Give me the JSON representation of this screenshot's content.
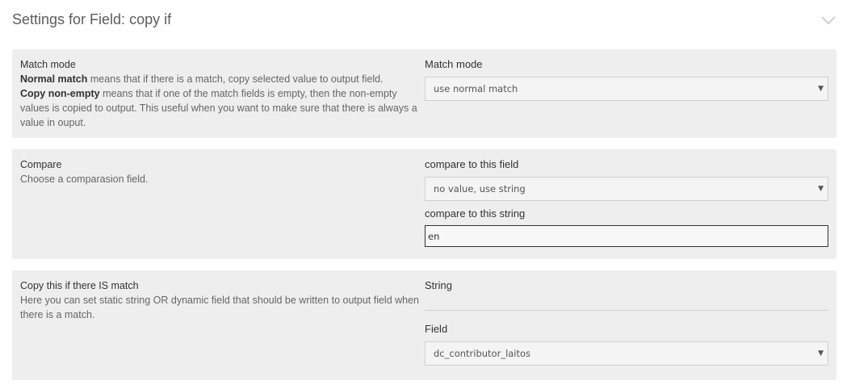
{
  "header": {
    "title": "Settings for Field: copy if"
  },
  "match_mode": {
    "title": "Match mode",
    "desc_bold_1": "Normal match",
    "desc_text_1": " means that if there is a match, copy selected value to output field.",
    "desc_bold_2": "Copy non-empty",
    "desc_text_2": " means that if one of the match fields is empty, then the non-empty values is copied to output. This useful when you want to make sure that there is always a value in ouput.",
    "field_label": "Match mode",
    "select_value": "use normal match"
  },
  "compare": {
    "title": "Compare",
    "desc": "Choose a comparasion field.",
    "field_label": "compare to this field",
    "field_select_value": "no value, use string",
    "string_label": "compare to this string",
    "string_value": "en"
  },
  "copy_match": {
    "title": "Copy this if there IS match",
    "desc": "Here you can set static string OR dynamic field that should be written to output field when there is a match.",
    "string_label": "String",
    "field_label": "Field",
    "field_select_value": "dc_contributor_laitos"
  },
  "icons": {
    "collapse": "chevron-down-icon",
    "dropdown": "dropdown-arrow-icon"
  },
  "arrow_glyph": "▼"
}
